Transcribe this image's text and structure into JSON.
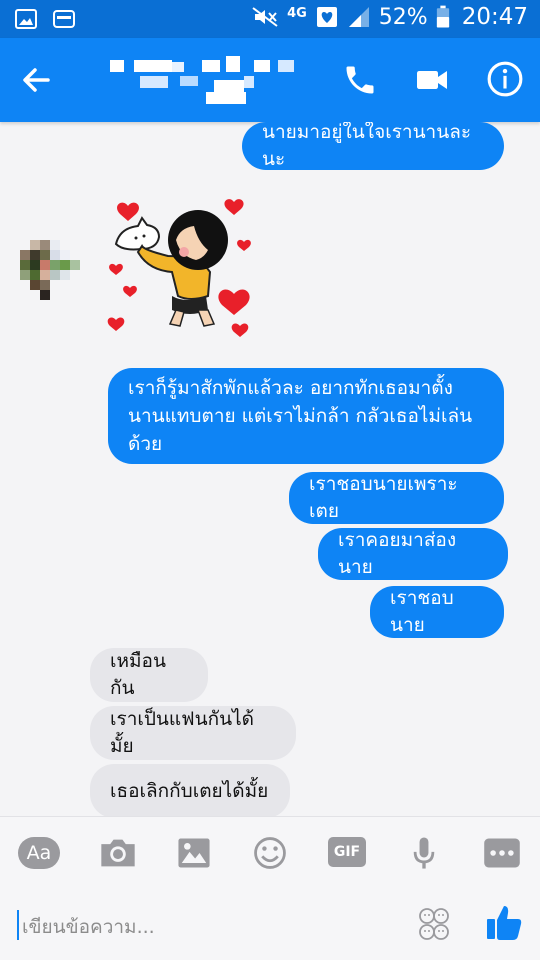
{
  "status_bar": {
    "battery": "52%",
    "time": "20:47",
    "network": "4G"
  },
  "header": {
    "contact_name_pixelated": true
  },
  "messages": [
    {
      "from": "me",
      "text": "นายมาอยู่ในใจเรานานละนะ"
    },
    {
      "from": "them",
      "type": "sticker"
    },
    {
      "from": "me",
      "text": "เราก็รู้มาสักพักแล้วละ อยากทักเธอมาตั้งนานแทบตาย แต่เราไม่กล้า กลัวเธอไม่เล่นด้วย",
      "lines": [
        "เราก็รู้มาสักพักแล้วละ อยากทักเธอมาตั้ง",
        "นานแทบตาย แต่เราไม่กล้า กลัวเธอไม่เล่น",
        "ด้วย"
      ]
    },
    {
      "from": "me",
      "text": "เราชอบนายเพราะเตย"
    },
    {
      "from": "me",
      "text": "เราคอยมาส่องนาย"
    },
    {
      "from": "me",
      "text": "เราชอบนาย"
    },
    {
      "from": "them",
      "text": "เหมือนกัน"
    },
    {
      "from": "them",
      "text": "เราเป็นแฟนกันได้มั้ย"
    },
    {
      "from": "them",
      "text": "เธอเลิกกับเตยได้มั้ย"
    }
  ],
  "composer": {
    "aa_label": "Aa",
    "gif_label": "GIF",
    "placeholder": "เขียนข้อความ..."
  },
  "colors": {
    "brand": "#0e84f5",
    "status_bar": "#0a6fd4",
    "their_bubble": "#e6e6ea",
    "icon_gray": "#9a9a9e"
  },
  "icons": [
    "back-arrow-icon",
    "phone-icon",
    "video-camera-icon",
    "info-icon",
    "camera-icon",
    "image-icon",
    "smiley-icon",
    "microphone-icon",
    "more-icon",
    "emoji-faces-icon",
    "thumbs-up-icon"
  ]
}
